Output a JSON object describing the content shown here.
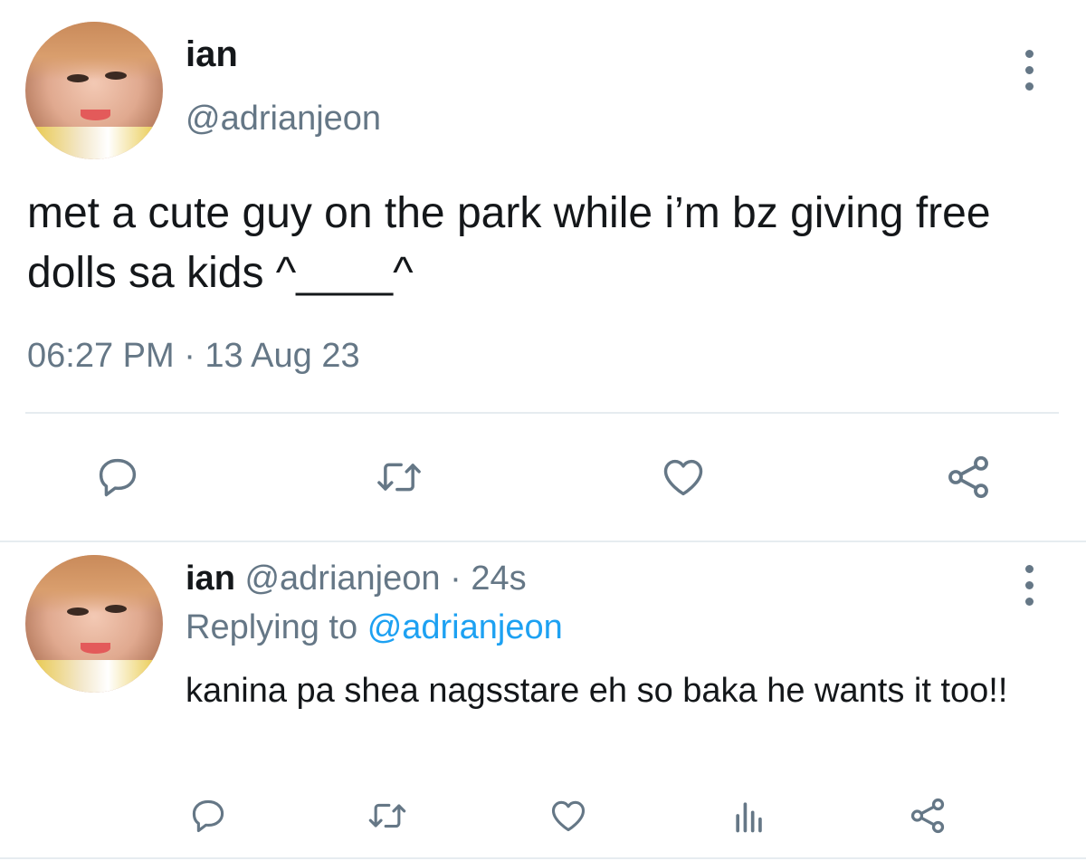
{
  "colors": {
    "text": "#14171a",
    "muted": "#657786",
    "link": "#1da1f2",
    "divider": "#e6ecf0",
    "icon": "#657786"
  },
  "main_tweet": {
    "author_name": "ian",
    "author_handle": "@adrianjeon",
    "text": "met a cute guy on the park while i’m bz giving free dolls sa kids ^____^",
    "timestamp": "06:27 PM · 13 Aug 23",
    "menu_icon": "more-vertical-icon",
    "actions": [
      {
        "name": "reply",
        "icon": "reply-icon"
      },
      {
        "name": "retweet",
        "icon": "retweet-icon"
      },
      {
        "name": "like",
        "icon": "heart-icon"
      },
      {
        "name": "share",
        "icon": "share-icon"
      }
    ]
  },
  "reply_tweet": {
    "author_name": "ian",
    "author_handle": "@adrianjeon",
    "separator": "·",
    "time_ago": "24s",
    "replying_prefix": "Replying to",
    "replying_to": "@adrianjeon",
    "text": "kanina pa shea nagsstare eh so baka he wants it too!!",
    "menu_icon": "more-vertical-icon",
    "actions": [
      {
        "name": "reply",
        "icon": "reply-icon"
      },
      {
        "name": "retweet",
        "icon": "retweet-icon"
      },
      {
        "name": "like",
        "icon": "heart-icon"
      },
      {
        "name": "analytics",
        "icon": "analytics-icon"
      },
      {
        "name": "share",
        "icon": "share-icon"
      }
    ]
  }
}
